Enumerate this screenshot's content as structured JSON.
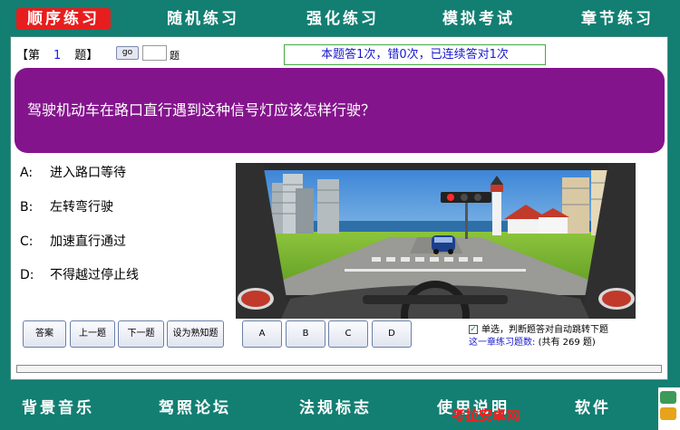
{
  "top_nav": {
    "tabs": [
      {
        "label": "顺序练习",
        "active": true
      },
      {
        "label": "随机练习",
        "active": false
      },
      {
        "label": "强化练习",
        "active": false
      },
      {
        "label": "模拟考试",
        "active": false
      },
      {
        "label": "章节练习",
        "active": false
      }
    ]
  },
  "question_header": {
    "prefix": "【第",
    "number": "1",
    "suffix": "题】",
    "go_label": "go",
    "jump_value": "",
    "jump_suffix": "题"
  },
  "stats_text": "本题答1次，错0次，已连续答对1次",
  "question_text": "驾驶机动车在路口直行遇到这种信号灯应该怎样行驶？",
  "options": [
    {
      "key": "A:",
      "text": "进入路口等待"
    },
    {
      "key": "B:",
      "text": "左转弯行驶"
    },
    {
      "key": "C:",
      "text": "加速直行通过"
    },
    {
      "key": "D:",
      "text": "不得越过停止线"
    }
  ],
  "buttons": {
    "answer": "答案",
    "prev": "上一题",
    "next": "下一题",
    "mark_known": "设为熟知题",
    "choice_a": "A",
    "choice_b": "B",
    "choice_c": "C",
    "choice_d": "D"
  },
  "auto_jump_label": "单选，判断题答对自动跳转下题",
  "auto_jump_checked": true,
  "chapter_label": "这一章练习题数:",
  "chapter_count_text": "(共有   269   题)",
  "bottom_nav": {
    "tabs": [
      "背景音乐",
      "驾照论坛",
      "法规标志",
      "使用说明",
      "软件"
    ]
  },
  "watermark_text": "考拉安卓网",
  "scene_signal": "red-light",
  "colors": {
    "teal": "#127f72",
    "active_tab": "#e81d1d",
    "question_bg": "#84148c",
    "stat_border": "#44aa44",
    "link_blue": "#1a1acc"
  }
}
